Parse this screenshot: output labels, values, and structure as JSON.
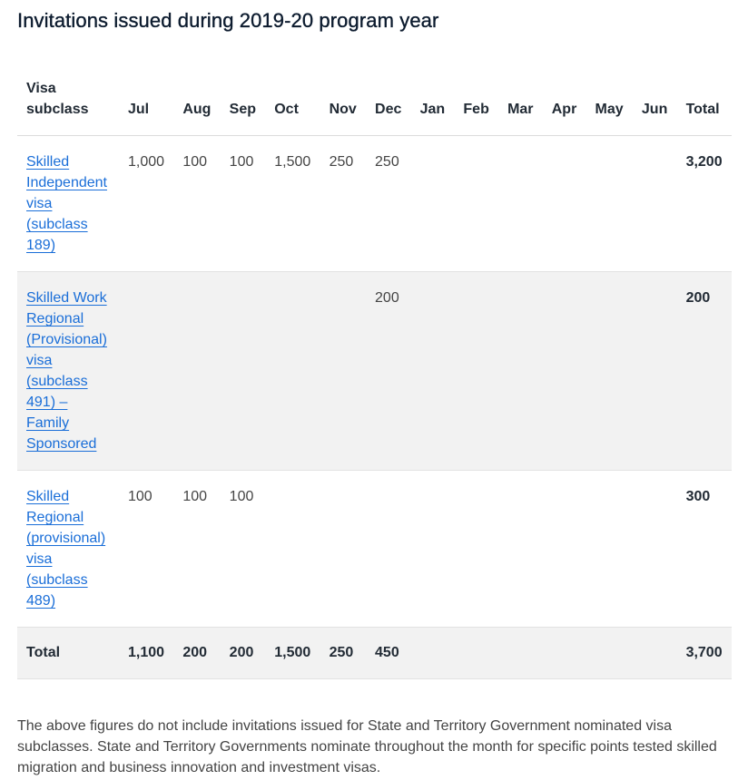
{
  "title": "Invitations issued during 2019-20 program year",
  "table": {
    "headers": [
      "Visa subclass",
      "Jul",
      "Aug",
      "Sep",
      "Oct",
      "Nov",
      "Dec",
      "Jan",
      "Feb",
      "Mar",
      "Apr",
      "May",
      "Jun",
      "Total"
    ],
    "header_visa_line1": "Visa",
    "header_visa_line2": "subclass",
    "rows": [
      {
        "visa": "Skilled Independent visa (subclass 189)",
        "values": [
          "1,000",
          "100",
          "100",
          "1,500",
          "250",
          "250",
          "",
          "",
          "",
          "",
          "",
          ""
        ],
        "total": "3,200"
      },
      {
        "visa": "Skilled Work Regional (Provisional) visa (subclass 491) – Family Sponsored",
        "values": [
          "",
          "",
          "",
          "",
          "",
          "200",
          "",
          "",
          "",
          "",
          "",
          ""
        ],
        "total": "200"
      },
      {
        "visa": "Skilled Regional (provisional) visa (subclass 489)",
        "values": [
          "100",
          "100",
          "100",
          "",
          "",
          "",
          "",
          "",
          "",
          "",
          "",
          ""
        ],
        "total": "300"
      }
    ],
    "total_row": {
      "label": "Total",
      "values": [
        "1,100",
        "200",
        "200",
        "1,500",
        "250",
        "450",
        "",
        "",
        "",
        "",
        "",
        ""
      ],
      "total": "3,700"
    }
  },
  "footnote": "The above figures do not include invitations issued for State and Territory Government nominated visa subclasses. State and Territory Governments nominate throughout the month for specific points tested skilled migration and business innovation and investment visas.",
  "colors": {
    "link": "#1a6ed8",
    "shaded_row": "#f2f2f2",
    "border": "#dcdcdc",
    "heading": "#0c1b2e"
  }
}
